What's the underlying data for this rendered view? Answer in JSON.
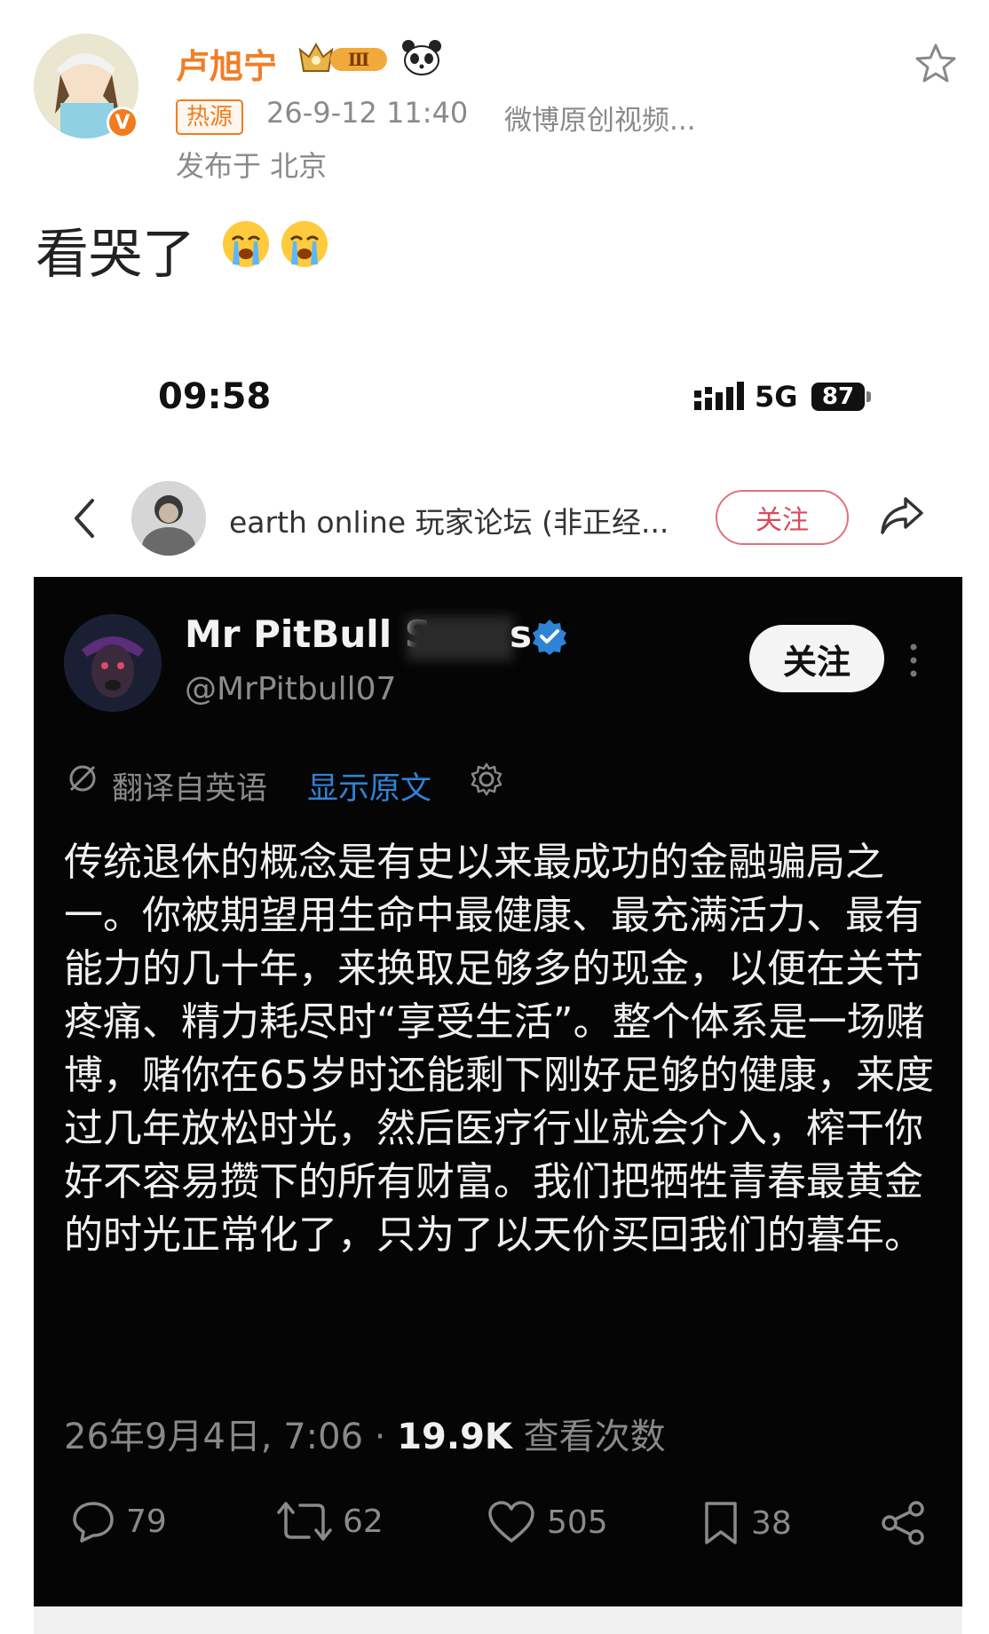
{
  "post": {
    "username": "卢旭宁",
    "crown_level": "Ⅲ",
    "hot_tag": "热源",
    "time": "26-9-12 11:40",
    "source": "微博原创视频...",
    "location": "发布于 北京",
    "text": "看哭了"
  },
  "phone": {
    "time": "09:58",
    "network": "5G",
    "battery": "87"
  },
  "forum": {
    "name": "earth online 玩家论坛 (非正经...",
    "follow_label": "关注"
  },
  "tweet": {
    "author": "Mr PitBull S",
    "author_tail": "s",
    "handle": "@MrPitbull07",
    "follow_label": "关注",
    "translated_from": "翻译自英语",
    "show_original": "显示原文",
    "body": "传统退休的概念是有史以来最成功的金融骗局之一。你被期望用生命中最健康、最充满活力、最有能力的几十年，来换取足够多的现金，以便在关节疼痛、精力耗尽时“享受生活”。整个体系是一场赌博，赌你在65岁时还能剩下刚好足够的健康，来度过几年放松时光，然后医疗行业就会介入，榨干你好不容易攒下的所有财富。我们把牺牲青春最黄金的时光正常化了，只为了以天价买回我们的暮年。",
    "date": "26年9月4日, 7:06 · ",
    "views": "19.9K",
    "views_label": " 查看次数",
    "replies": "79",
    "retweets": "62",
    "likes": "505",
    "bookmarks": "38"
  },
  "colors": {
    "username": "#f07e28",
    "link_blue": "#2f83d6",
    "follow_pink": "#d64c5a",
    "card_bg": "#050505"
  }
}
